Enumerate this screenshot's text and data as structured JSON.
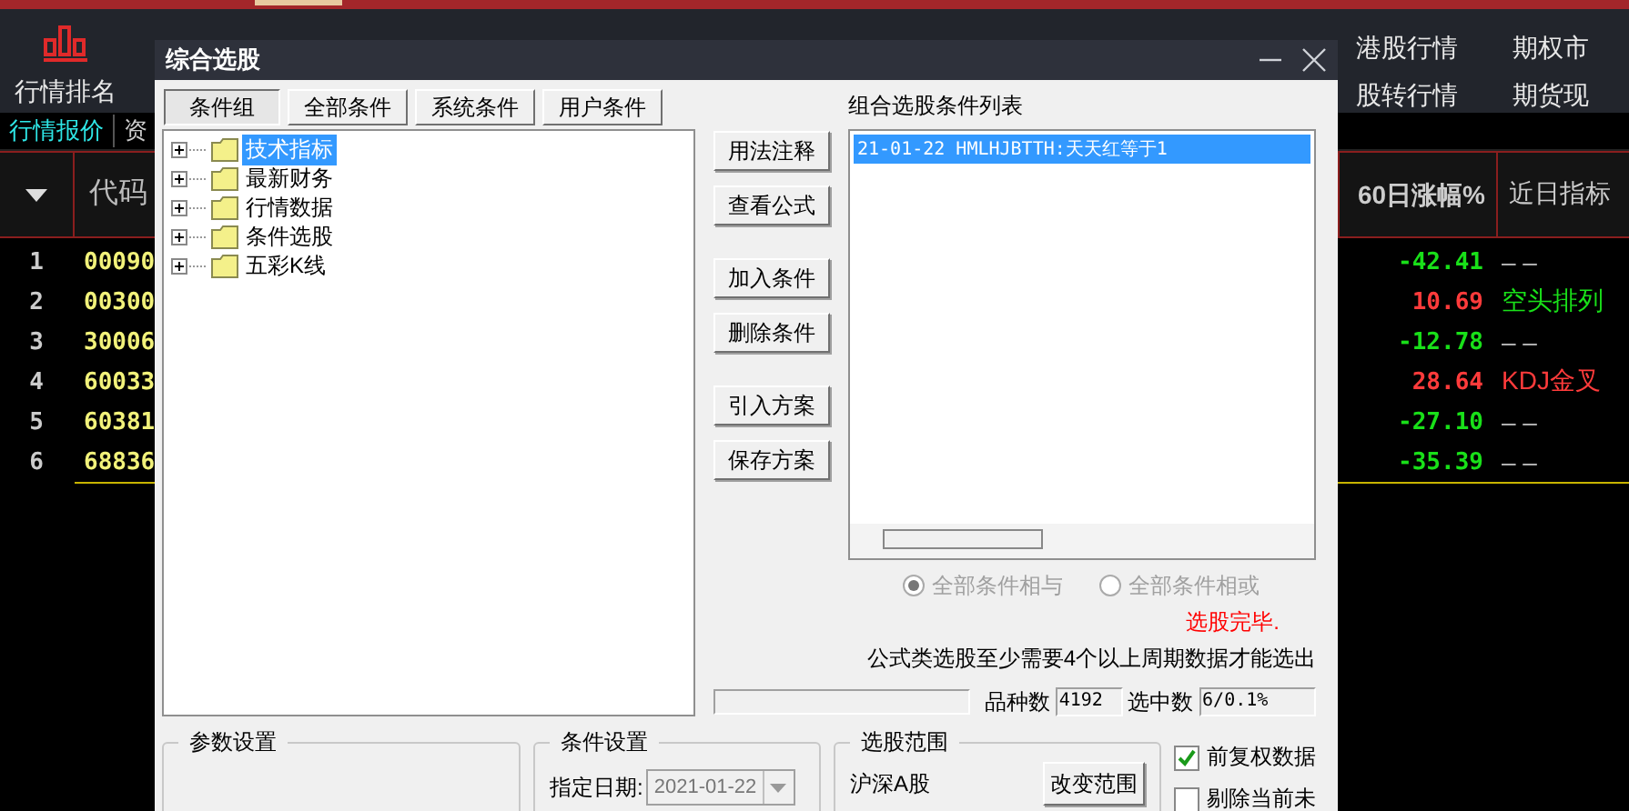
{
  "app": {
    "nav_left": {
      "label": "行情排名"
    },
    "nav_right": [
      {
        "label": "港股行情"
      },
      {
        "label": "期权市"
      },
      {
        "label": "股转行情"
      },
      {
        "label": "期货现"
      }
    ],
    "subtabs": [
      {
        "label": "行情报价",
        "selected": true
      },
      {
        "label": "资",
        "selected": false
      }
    ],
    "columns": {
      "code": "代码",
      "change": "60日涨幅%",
      "signal": "近日指标"
    },
    "rows": [
      {
        "rank": "1",
        "code": "00090",
        "change": {
          "text": "-42.41",
          "color": "#19e019"
        },
        "signal": {
          "text": "– –",
          "color": "#bbbbbb"
        }
      },
      {
        "rank": "2",
        "code": "00300",
        "change": {
          "text": "10.69",
          "color": "#ff3b3b"
        },
        "signal": {
          "text": "空头排列",
          "color": "#19e019"
        }
      },
      {
        "rank": "3",
        "code": "30006",
        "change": {
          "text": "-12.78",
          "color": "#19e019"
        },
        "signal": {
          "text": "– –",
          "color": "#bbbbbb"
        }
      },
      {
        "rank": "4",
        "code": "60033",
        "change": {
          "text": "28.64",
          "color": "#ff3b3b"
        },
        "signal": {
          "text": "KDJ金叉",
          "color": "#ff3b3b"
        }
      },
      {
        "rank": "5",
        "code": "60381",
        "change": {
          "text": "-27.10",
          "color": "#19e019"
        },
        "signal": {
          "text": "– –",
          "color": "#bbbbbb"
        }
      },
      {
        "rank": "6",
        "code": "68836",
        "change": {
          "text": "-35.39",
          "color": "#19e019"
        },
        "signal": {
          "text": "– –",
          "color": "#bbbbbb"
        }
      }
    ]
  },
  "dialog": {
    "title": "综合选股",
    "tabs": [
      {
        "label": "条件组",
        "selected": true
      },
      {
        "label": "全部条件",
        "selected": false
      },
      {
        "label": "系统条件",
        "selected": false
      },
      {
        "label": "用户条件",
        "selected": false
      }
    ],
    "tree": [
      {
        "label": "技术指标",
        "selected": true,
        "expanded": false
      },
      {
        "label": "最新财务",
        "selected": false,
        "expanded": false
      },
      {
        "label": "行情数据",
        "selected": false,
        "expanded": false
      },
      {
        "label": "条件选股",
        "selected": false,
        "expanded": false
      },
      {
        "label": "五彩K线",
        "selected": false,
        "expanded": false
      }
    ],
    "action_groups": [
      [
        "用法注释",
        "查看公式"
      ],
      [
        "加入条件",
        "删除条件"
      ],
      [
        "引入方案",
        "保存方案"
      ]
    ],
    "list_title": "组合选股条件列表",
    "list": [
      {
        "text": "21-01-22 HMLHJBTTH:天天红等于1",
        "selected": true
      }
    ],
    "logic_disabled": true,
    "logic": [
      {
        "label": "全部条件相与",
        "selected": true
      },
      {
        "label": "全部条件相或",
        "selected": false
      }
    ],
    "status": "选股完毕.",
    "note": "公式类选股至少需要4个以上周期数据才能选出",
    "progress": {
      "level": 0
    },
    "count_label": "品种数",
    "count": "4192",
    "hit_label": "选中数",
    "hit": "6/0.1%",
    "param_title": "参数设置",
    "cond_title": "条件设置",
    "date_label": "指定日期:",
    "date": "2021-01-22",
    "scope_title": "选股范围",
    "scope": "沪深A股",
    "scope_button": "改变范围",
    "options": [
      {
        "label": "前复权数据",
        "checked": true
      },
      {
        "label": "剔除当前未",
        "checked": false
      }
    ]
  }
}
